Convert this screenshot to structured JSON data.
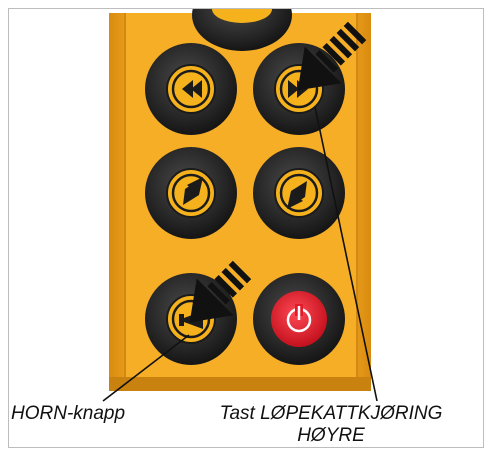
{
  "captions": {
    "horn": "HORN-knapp",
    "trolley_line1": "Tast LØPEKATTKJØRING",
    "trolley_line2": "HØYRE"
  },
  "colors": {
    "housing": "#f2a51c",
    "button_rubber": "#2a2a2a",
    "button_ring": "#f5b21d",
    "stop_button": "#e11c2a",
    "arrow_stripes": "#111111"
  },
  "buttons": [
    {
      "id": "top-partial",
      "icon": "partial-button"
    },
    {
      "id": "trolley-left",
      "icon": "double-chevron-left-icon"
    },
    {
      "id": "trolley-right",
      "icon": "double-chevron-right-icon"
    },
    {
      "id": "diag-up-right",
      "icon": "diagonal-arrow-up-right-icon"
    },
    {
      "id": "diag-down-left",
      "icon": "diagonal-arrow-down-left-icon"
    },
    {
      "id": "horn",
      "icon": "horn-icon"
    },
    {
      "id": "stop",
      "icon": "power-icon"
    }
  ]
}
